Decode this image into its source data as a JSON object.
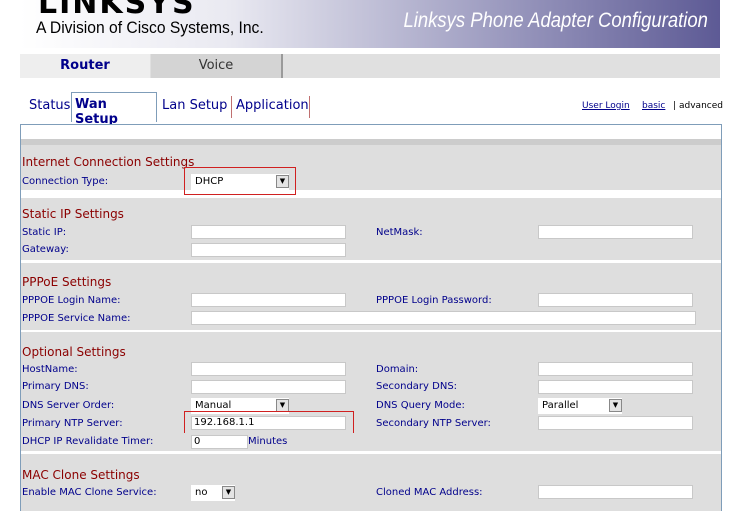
{
  "header": {
    "logo_text": "LINKSYS",
    "division": "A Division of Cisco Systems, Inc.",
    "config_title": "Linksys Phone Adapter Configuration"
  },
  "main_tabs": {
    "router": "Router",
    "voice": "Voice"
  },
  "sub_tabs": {
    "status": "Status",
    "wan_setup": "Wan Setup",
    "lan_setup": "Lan Setup",
    "application": "Application"
  },
  "top_links": {
    "user_login": "User Login",
    "basic": "basic",
    "separator": "|",
    "advanced": "advanced"
  },
  "sections": {
    "internet": {
      "title": "Internet Connection Settings",
      "connection_type_label": "Connection Type:",
      "connection_type_value": "DHCP"
    },
    "static_ip": {
      "title": "Static IP Settings",
      "static_ip_label": "Static IP:",
      "netmask_label": "NetMask:",
      "gateway_label": "Gateway:",
      "static_ip_value": "",
      "netmask_value": "",
      "gateway_value": ""
    },
    "pppoe": {
      "title": "PPPoE Settings",
      "login_name_label": "PPPOE Login Name:",
      "login_password_label": "PPPOE Login Password:",
      "service_name_label": "PPPOE Service Name:",
      "login_name_value": "",
      "login_password_value": "",
      "service_name_value": ""
    },
    "optional": {
      "title": "Optional Settings",
      "hostname_label": "HostName:",
      "domain_label": "Domain:",
      "primary_dns_label": "Primary DNS:",
      "secondary_dns_label": "Secondary DNS:",
      "dns_order_label": "DNS Server Order:",
      "dns_order_value": "Manual",
      "dns_query_label": "DNS Query Mode:",
      "dns_query_value": "Parallel",
      "primary_ntp_label": "Primary NTP Server:",
      "primary_ntp_value": "192.168.1.1",
      "secondary_ntp_label": "Secondary NTP Server:",
      "dhcp_revalidate_label": "DHCP IP Revalidate Timer:",
      "dhcp_revalidate_value": "0",
      "dhcp_revalidate_unit": "Minutes",
      "hostname_value": "",
      "domain_value": "",
      "primary_dns_value": "",
      "secondary_dns_value": "",
      "secondary_ntp_value": ""
    },
    "mac_clone": {
      "title": "MAC Clone Settings",
      "enable_label": "Enable MAC Clone Service:",
      "enable_value": "no",
      "cloned_mac_label": "Cloned MAC Address:",
      "cloned_mac_value": ""
    }
  },
  "icons": {
    "dropdown_arrow": "▼"
  },
  "colors": {
    "label_blue": "#00008b",
    "section_red": "#8b0000",
    "row_gray": "#dedede",
    "highlight_red": "#d02020"
  }
}
